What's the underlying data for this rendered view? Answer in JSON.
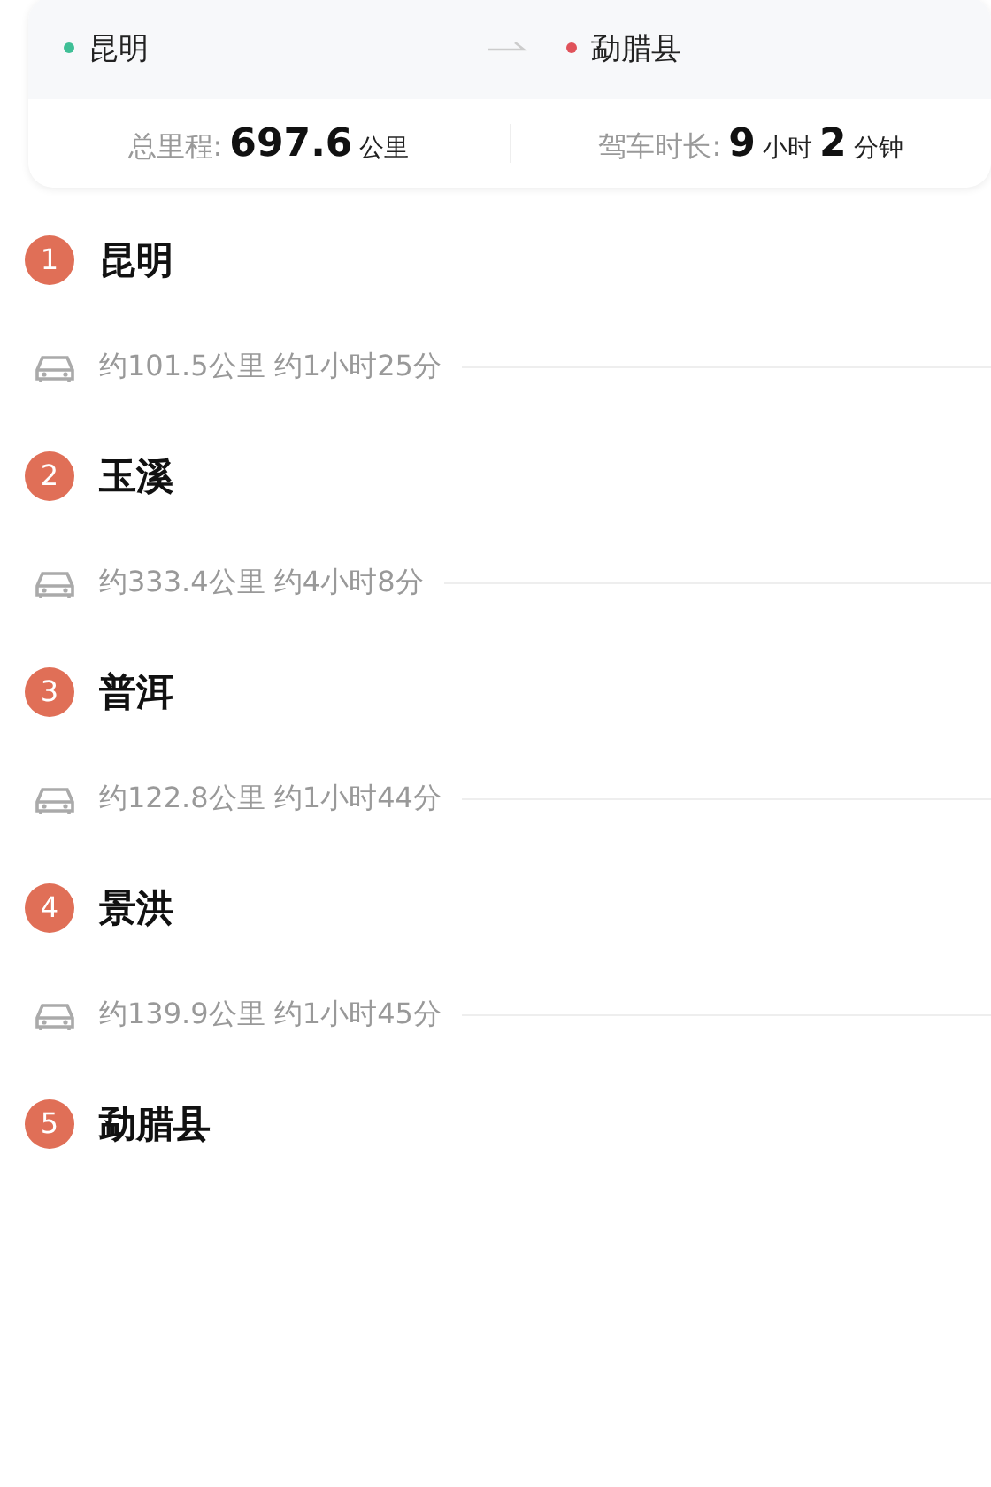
{
  "route": {
    "origin": {
      "name": "昆明",
      "color": "#3fbf96"
    },
    "destination": {
      "name": "勐腊县",
      "color": "#e0525a"
    }
  },
  "summary": {
    "distance_label": "总里程:",
    "distance_value": "697.6",
    "distance_unit": "公里",
    "duration_label": "驾车时长:",
    "hours": "9",
    "hours_unit": "小时",
    "minutes": "2",
    "minutes_unit": "分钟"
  },
  "stops": [
    {
      "number": "1",
      "name": "昆明",
      "leg": "约101.5公里 约1小时25分"
    },
    {
      "number": "2",
      "name": "玉溪",
      "leg": "约333.4公里 约4小时8分"
    },
    {
      "number": "3",
      "name": "普洱",
      "leg": "约122.8公里 约1小时44分"
    },
    {
      "number": "4",
      "name": "景洪",
      "leg": "约139.9公里 约1小时45分"
    },
    {
      "number": "5",
      "name": "勐腊县"
    }
  ]
}
